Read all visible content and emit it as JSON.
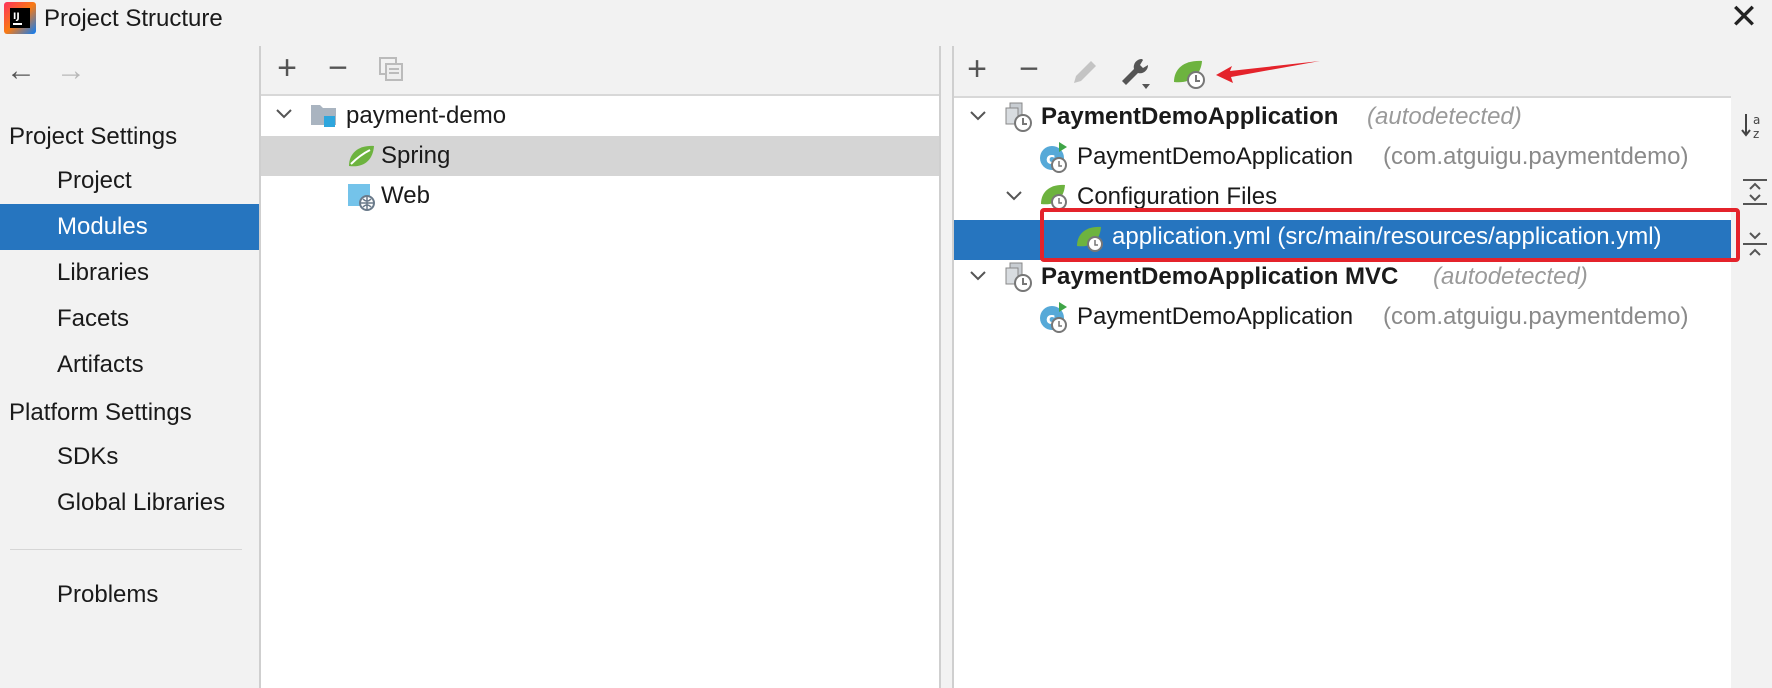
{
  "window": {
    "title": "Project Structure",
    "close_glyph": "✕"
  },
  "nav": {
    "back_glyph": "←",
    "forward_glyph": "→",
    "project_settings_header": "Project Settings",
    "platform_settings_header": "Platform Settings",
    "items": {
      "project": "Project",
      "modules": "Modules",
      "libraries": "Libraries",
      "facets": "Facets",
      "artifacts": "Artifacts",
      "sdks": "SDKs",
      "global_libraries": "Global Libraries",
      "problems": "Problems"
    },
    "selected": "Modules"
  },
  "modules_panel": {
    "toolbar": {
      "add": "+",
      "remove": "−"
    },
    "tree": {
      "root": "payment-demo",
      "children": [
        "Spring",
        "Web"
      ],
      "selected": "Spring"
    }
  },
  "spring_panel": {
    "toolbar": {
      "add": "+",
      "remove": "−"
    },
    "contexts": [
      {
        "name": "PaymentDemoApplication",
        "suffix": "(autodetected)",
        "app_class": "PaymentDemoApplication",
        "app_package": "(com.atguigu.paymentdemo)",
        "config_group": "Configuration Files",
        "config_file": "application.yml (src/main/resources/application.yml)"
      },
      {
        "name": "PaymentDemoApplication MVC",
        "suffix": "(autodetected)",
        "app_class": "PaymentDemoApplication",
        "app_package": "(com.atguigu.paymentdemo)"
      }
    ],
    "selected": "application.yml (src/main/resources/application.yml)"
  },
  "colors": {
    "selection": "#2675bf",
    "annotation_red": "#e4232b",
    "spring_green": "#6db33f"
  },
  "icons": [
    "app-logo-icon",
    "back-arrow-icon",
    "forward-arrow-icon",
    "close-icon",
    "add-icon",
    "remove-icon",
    "copy-icon",
    "edit-icon",
    "wrench-icon",
    "spring-facet-icon",
    "folder-module-icon",
    "web-icon",
    "spring-context-icon",
    "spring-boot-app-icon",
    "config-files-icon",
    "spring-config-file-icon",
    "sort-alpha-icon",
    "expand-all-icon",
    "collapse-all-icon",
    "annotation-arrow"
  ]
}
